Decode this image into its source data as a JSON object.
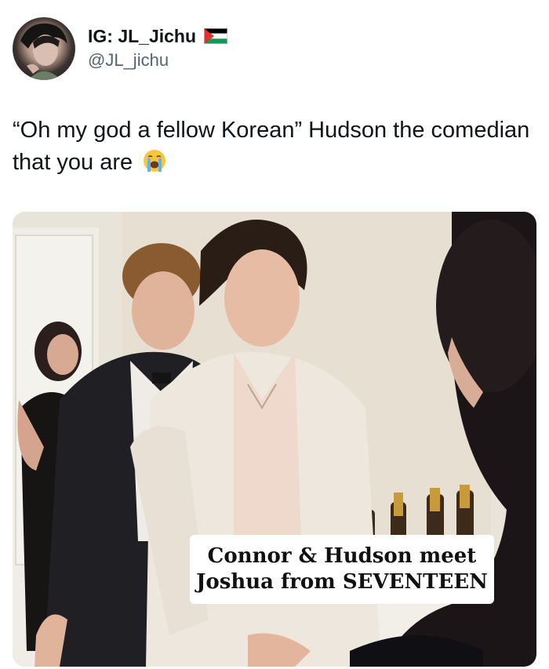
{
  "tweet": {
    "display_name": "IG: JL_Jichu",
    "handle": "@JL_jichu",
    "flag_icon": "palestine-flag-icon",
    "text": "“Oh my god a fellow Korean” Hudson the comedian that you are",
    "emoji": "loudly-crying-face-icon"
  },
  "media": {
    "caption_line1": "Connor & Hudson meet",
    "caption_line2": "Joshua from SEVENTEEN"
  },
  "colors": {
    "text": "#0f1419",
    "handle": "#536471",
    "background": "#ffffff"
  }
}
